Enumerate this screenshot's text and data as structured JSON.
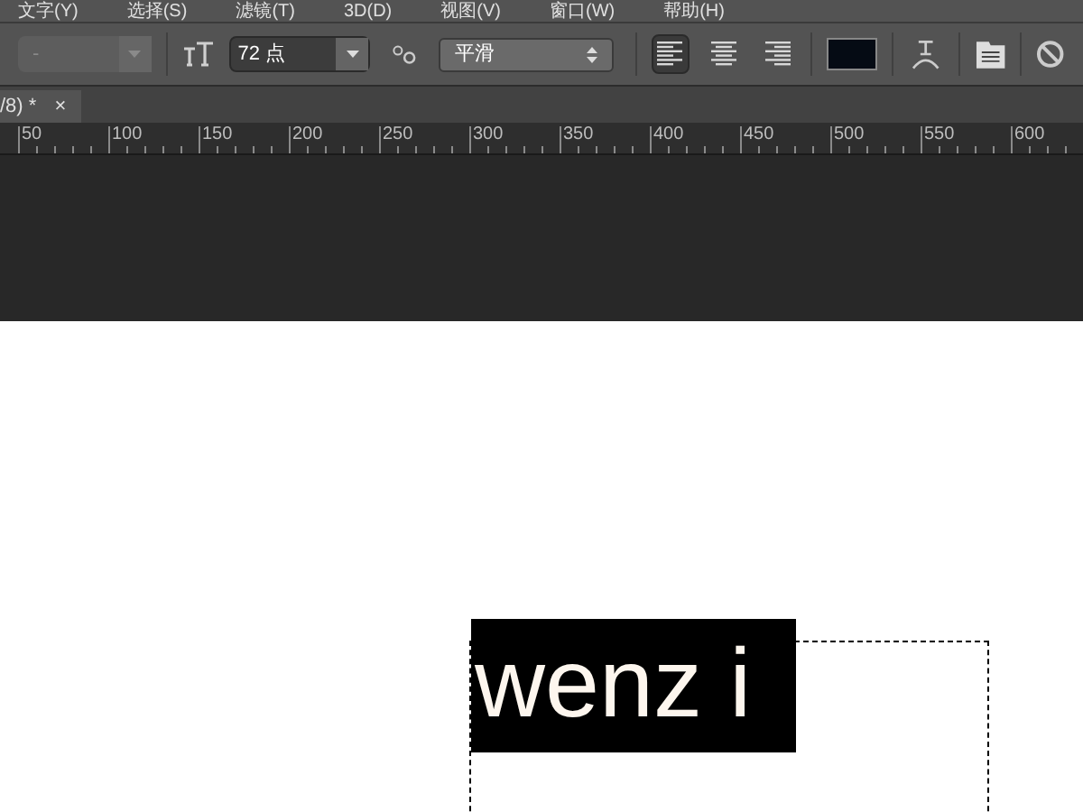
{
  "menu": [
    "文字(Y)",
    "选择(S)",
    "滤镜(T)",
    "3D(D)",
    "视图(V)",
    "窗口(W)",
    "帮助(H)"
  ],
  "options_bar": {
    "font_style": {
      "value": "-",
      "disabled": true
    },
    "font_size": "72 点",
    "antialias": "平滑",
    "alignments": [
      {
        "kind": "left",
        "selected": true
      },
      {
        "kind": "center",
        "selected": false
      },
      {
        "kind": "right",
        "selected": false
      }
    ],
    "text_color": {
      "color": "#050b14"
    }
  },
  "document_tab": {
    "title": "/8) *",
    "close": "×"
  },
  "ruler": [
    "50",
    "100",
    "150",
    "200",
    "250",
    "300",
    "350",
    "400",
    "450",
    "500",
    "550",
    "600"
  ],
  "canvas": {
    "text": "wenz i"
  }
}
